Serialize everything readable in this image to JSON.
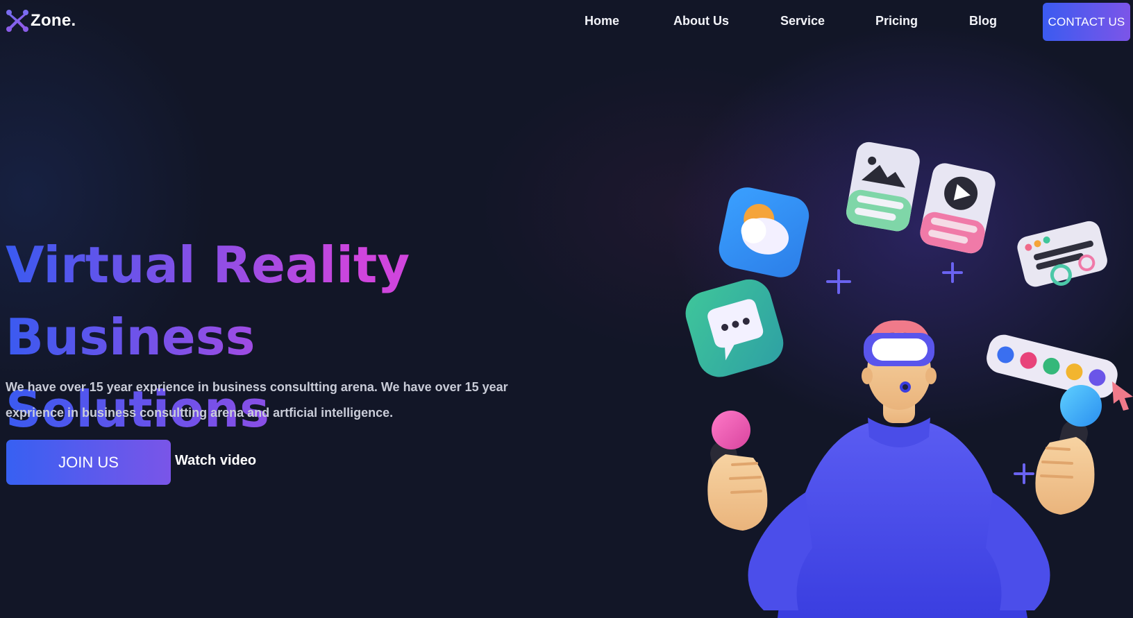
{
  "brand": {
    "name": "Zone."
  },
  "nav": {
    "links": [
      "Home",
      "About Us",
      "Service",
      "Pricing",
      "Blog"
    ],
    "contact_label": "CONTACT US"
  },
  "hero": {
    "title_line1": "Virtual Reality Business",
    "title_line2": "Solutions",
    "description": "We have over 15 year exprience in business consultting arena. We have over 15 year exprience in business consultting arena and artficial intelligence.",
    "join_label": "JOIN US",
    "watch_label": "Watch video"
  },
  "illustration": {
    "subject": "vr-person-with-floating-app-icons",
    "icons": [
      "weather-icon",
      "image-card-icon",
      "play-card-icon",
      "chat-bubble-icon",
      "settings-panel-icon",
      "color-palette-icon",
      "cursor-icon"
    ]
  },
  "colors": {
    "background": "#121627",
    "accent_start": "#3760f2",
    "accent_end": "#7a55e8",
    "headline_pink": "#d146db"
  }
}
